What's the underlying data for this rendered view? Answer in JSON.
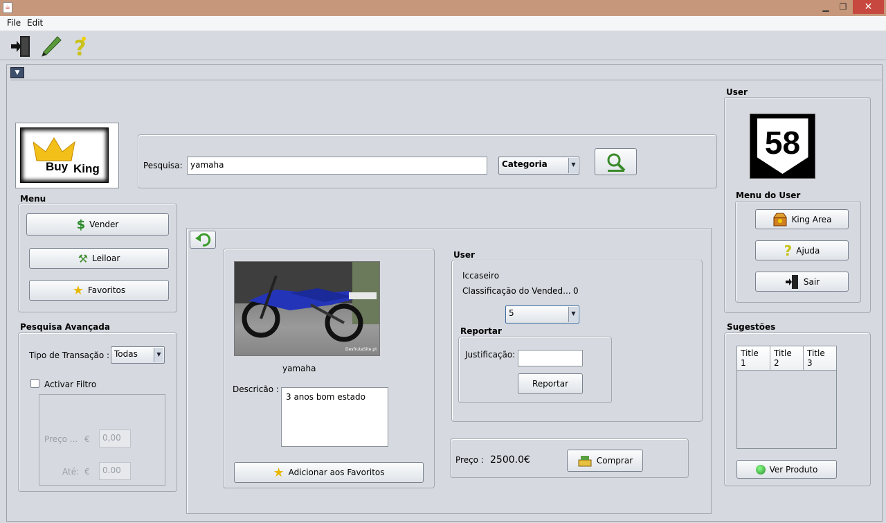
{
  "menu_bar": {
    "file": "File",
    "edit": "Edit"
  },
  "toolbar": {
    "exit_icon": "exit-door-icon",
    "edit_icon": "pen-icon",
    "help_icon": "question-icon"
  },
  "brand": {
    "logo_text_1": "Buy",
    "logo_text_2": "King"
  },
  "search": {
    "label": "Pesquisa:",
    "value": "yamaha",
    "category": "Categoria"
  },
  "menu": {
    "title": "Menu",
    "vender": "Vender",
    "leiloar": "Leiloar",
    "favoritos": "Favoritos"
  },
  "advanced": {
    "title": "Pesquisa Avançada",
    "tipo_label": "Tipo de Transação :",
    "tipo_value": "Todas",
    "filter_label": "Activar Filtro",
    "preco_label": "Preço ...",
    "ate_label": "Até:",
    "currency": "€",
    "preco_value": "0,00",
    "ate_value": "0.00"
  },
  "product": {
    "name": "yamaha",
    "descricao_label": "Descricão :",
    "descricao": "3 anos bom estado",
    "add_fav": "Adicionar aos Favoritos",
    "photo_caption": "DesfrutaSite.pt"
  },
  "seller": {
    "title": "User",
    "username": "Iccaseiro",
    "rating_label": "Classificação do Vended...",
    "rating_value": "0",
    "rating_select": "5",
    "report_title": "Reportar",
    "justificacao_label": "Justificação:",
    "report_button": "Reportar"
  },
  "purchase": {
    "preco_label": "Preço :",
    "preco_value": "2500.0€",
    "comprar": "Comprar"
  },
  "user_panel": {
    "title": "User",
    "avatar_number": "58",
    "menu_title": "Menu do User",
    "king_area": "King Area",
    "ajuda": "Ajuda",
    "sair": "Sair"
  },
  "suggestions": {
    "title": "Sugestões",
    "columns": [
      "Title 1",
      "Title 2",
      "Title 3"
    ],
    "ver_produto": "Ver Produto"
  }
}
